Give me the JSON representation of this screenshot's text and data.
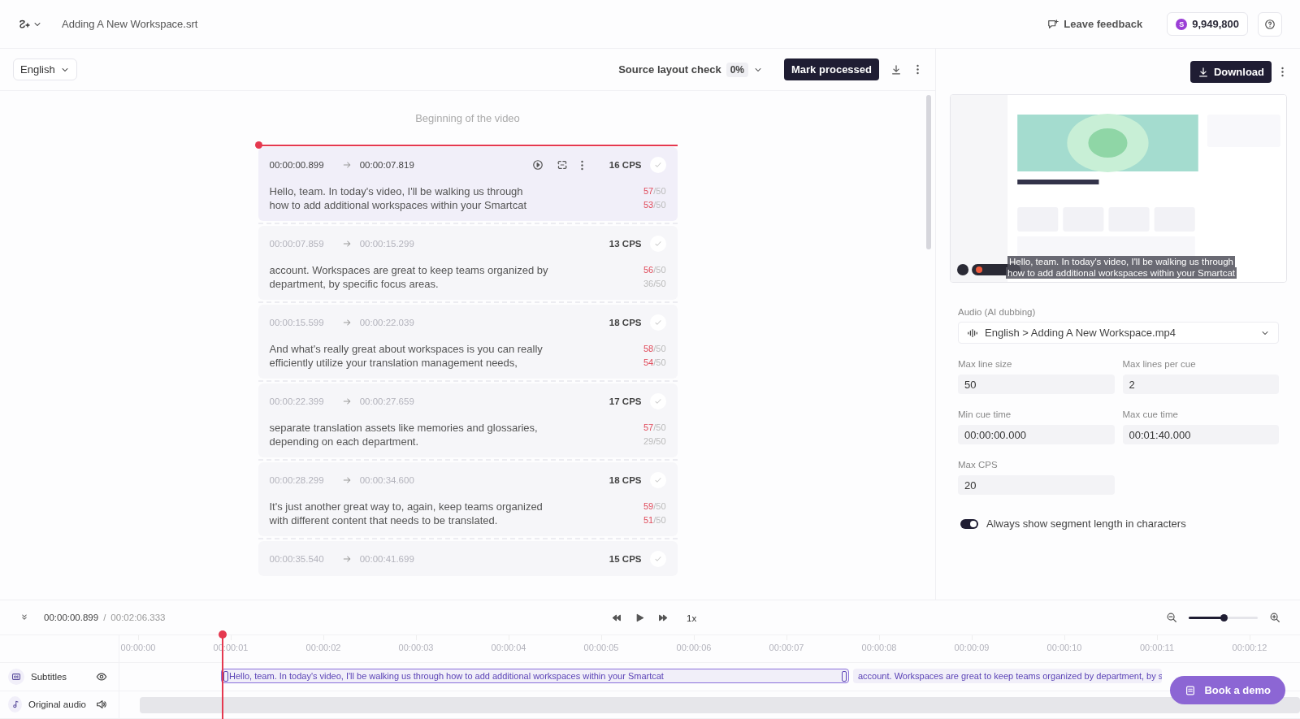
{
  "header": {
    "file_name": "Adding A New Workspace.srt",
    "feedback": "Leave feedback",
    "balance_badge": "S",
    "balance": "9,949,800"
  },
  "toolbar": {
    "language": "English",
    "layout_check_label": "Source layout check",
    "layout_check_value": "0%",
    "mark_button": "Mark processed"
  },
  "list_start": "Beginning of the video",
  "segments": [
    {
      "start": "00:00:00.899",
      "end": "00:00:07.819",
      "cps": "16 CPS",
      "selected": true,
      "lines": [
        {
          "text": "Hello, team. In today's video, I'll be walking us through",
          "count": "57",
          "limit": "/50",
          "over": true
        },
        {
          "text": "how to add additional workspaces within your Smartcat",
          "count": "53",
          "limit": "/50",
          "over": true
        }
      ]
    },
    {
      "start": "00:00:07.859",
      "end": "00:00:15.299",
      "cps": "13 CPS",
      "selected": false,
      "lines": [
        {
          "text": "account. Workspaces are great to keep teams organized by",
          "count": "56",
          "limit": "/50",
          "over": true
        },
        {
          "text": "department, by specific focus areas.",
          "count": "36",
          "limit": "/50",
          "over": false
        }
      ]
    },
    {
      "start": "00:00:15.599",
      "end": "00:00:22.039",
      "cps": "18 CPS",
      "selected": false,
      "lines": [
        {
          "text": "And what's really great about workspaces is you can really",
          "count": "58",
          "limit": "/50",
          "over": true
        },
        {
          "text": "efficiently utilize your translation management needs,",
          "count": "54",
          "limit": "/50",
          "over": true
        }
      ]
    },
    {
      "start": "00:00:22.399",
      "end": "00:00:27.659",
      "cps": "17 CPS",
      "selected": false,
      "lines": [
        {
          "text": "separate translation assets like memories and glossaries,",
          "count": "57",
          "limit": "/50",
          "over": true
        },
        {
          "text": "depending on each department.",
          "count": "29",
          "limit": "/50",
          "over": false
        }
      ]
    },
    {
      "start": "00:00:28.299",
      "end": "00:00:34.600",
      "cps": "18 CPS",
      "selected": false,
      "lines": [
        {
          "text": "It's just another great way to, again, keep teams organized",
          "count": "59",
          "limit": "/50",
          "over": true
        },
        {
          "text": "with different content that needs to be translated.",
          "count": "51",
          "limit": "/50",
          "over": true
        }
      ]
    },
    {
      "start": "00:00:35.540",
      "end": "00:00:41.699",
      "cps": "15 CPS",
      "selected": false
    }
  ],
  "side": {
    "download_button": "Download",
    "preview": {
      "kind": "picture",
      "caption": [
        "Hello, team. In today's video, I'll be walking us through",
        "how to add additional workspaces within your Smartcat"
      ]
    },
    "audio": {
      "label": "Audio (AI dubbing)",
      "value": "English > Adding A New Workspace.mp4"
    },
    "fields": [
      {
        "label": "Max line size",
        "value": "50"
      },
      {
        "label": "Max lines per cue",
        "value": "2"
      },
      {
        "label": "Min cue time",
        "value": "00:00:00.000"
      },
      {
        "label": "Max cue time",
        "value": "00:01:40.000"
      },
      {
        "label": "Max CPS",
        "value": "20"
      }
    ],
    "toggle": {
      "label": "Always show segment length in characters",
      "on": true
    }
  },
  "player": {
    "current": "00:00:00.899",
    "separator": "/",
    "total": "00:02:06.333",
    "speed": "1x",
    "zoom": {
      "level": 0.5
    }
  },
  "timeline": {
    "ticks": [
      "00:00:00",
      "00:00:01",
      "00:00:02",
      "00:00:03",
      "00:00:04",
      "00:00:05",
      "00:00:06",
      "00:00:07",
      "00:00:08",
      "00:00:09",
      "00:00:10",
      "00:00:11",
      "00:00:12"
    ],
    "tracks": [
      {
        "kind": "subtitles",
        "label": "Subtitles",
        "clips": [
          {
            "text": "Hello, team. In today's video, I'll be walking us through how to add additional workspaces within your Smartcat",
            "selected": true
          },
          {
            "text": "account. Workspaces are great to keep teams organized by department, by s",
            "selected": false
          }
        ]
      },
      {
        "kind": "audio",
        "label": "Original audio"
      }
    ]
  },
  "demo_button": "Book a demo"
}
